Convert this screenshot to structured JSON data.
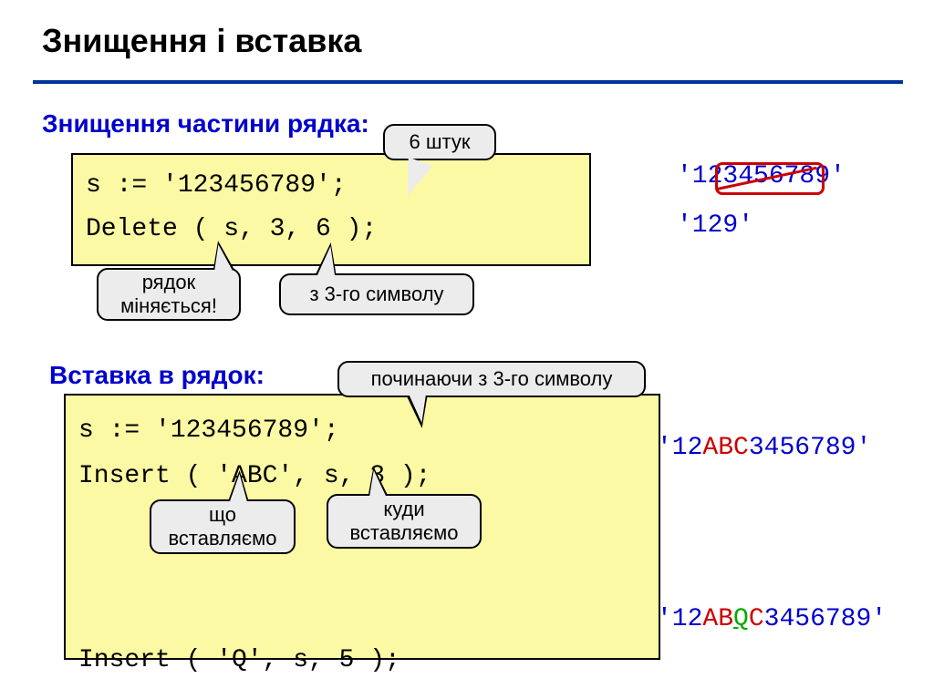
{
  "title": "Знищення і вставка",
  "sections": {
    "delete": {
      "heading": "Знищення частини рядка:",
      "code_line1": "s := '123456789';",
      "code_line2": "Delete ( s, 3, 6 );",
      "callouts": {
        "count6": "6 штук",
        "row_changes": "рядок\nміняється!",
        "from3": "з 3-го символу"
      },
      "result1": "'123456789'",
      "result2": "'129'"
    },
    "insert": {
      "heading": "Вставка в рядок:",
      "code_line1": "s := '123456789';",
      "code_line2": "Insert ( 'ABC', s, 3 );",
      "code_line3": "Insert ( 'Q', s, 5 );",
      "callouts": {
        "starting_from3": "починаючи з 3-го символу",
        "what_insert": "що\nвставляємо",
        "where_insert": "куди\nвставляємо"
      },
      "result1_prefix": "'12",
      "result1_mid": "ABC",
      "result1_suffix": "3456789'",
      "result2_prefix": "'12",
      "result2_a": "AB",
      "result2_q": "Q",
      "result2_c": "C",
      "result2_suffix": "3456789'"
    }
  }
}
